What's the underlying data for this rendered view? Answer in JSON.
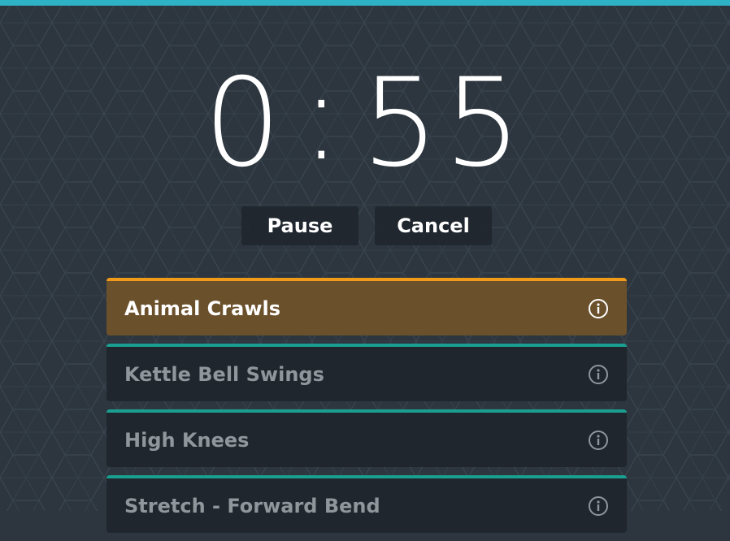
{
  "timer": {
    "minutes": "0",
    "separator": ":",
    "seconds": "55"
  },
  "controls": {
    "pause_label": "Pause",
    "cancel_label": "Cancel"
  },
  "exercises": [
    {
      "label": "Animal Crawls",
      "active": true,
      "icon": "info-icon"
    },
    {
      "label": "Kettle Bell Swings",
      "active": false,
      "icon": "info-icon"
    },
    {
      "label": "High Knees",
      "active": false,
      "icon": "info-icon"
    },
    {
      "label": "Stretch - Forward Bend",
      "active": false,
      "icon": "info-icon"
    }
  ],
  "colors": {
    "background": "#2d363f",
    "top_bar": "#2eb3c6",
    "active_item": "#6b502c",
    "active_accent": "#f09a1a",
    "item_accent": "#1a9e90",
    "item_bg": "#1f262d"
  }
}
